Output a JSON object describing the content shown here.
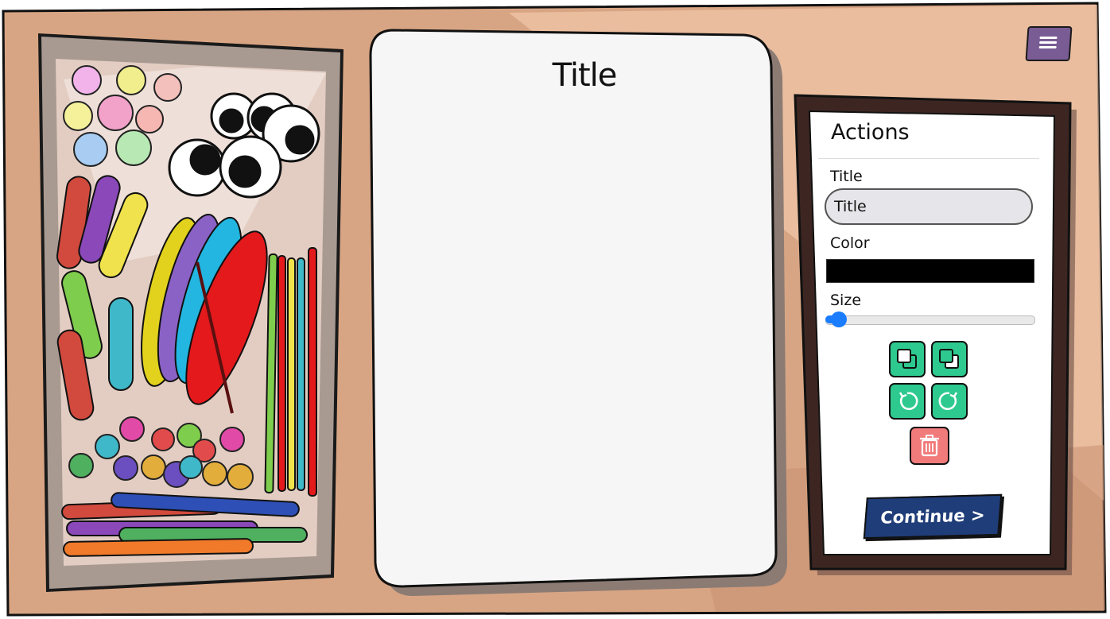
{
  "canvas": {
    "title": "Title"
  },
  "menu": {
    "icon": "hamburger-menu-icon"
  },
  "actions_panel": {
    "heading": "Actions",
    "title_label": "Title",
    "title_value": "Title",
    "color_label": "Color",
    "color_value": "#000000",
    "size_label": "Size",
    "size_value": 0.05,
    "buttons": [
      "bring-to-front-icon",
      "send-to-back-icon",
      "rotate-left-icon",
      "rotate-right-icon",
      "trash-icon"
    ],
    "continue_label": "Continue >"
  },
  "colors": {
    "action_button": "#2ec98f",
    "delete_button": "#f17a7a",
    "continue_button": "#1f3d78",
    "menu_button": "#7a5c95",
    "slider": "#1a7cff"
  }
}
